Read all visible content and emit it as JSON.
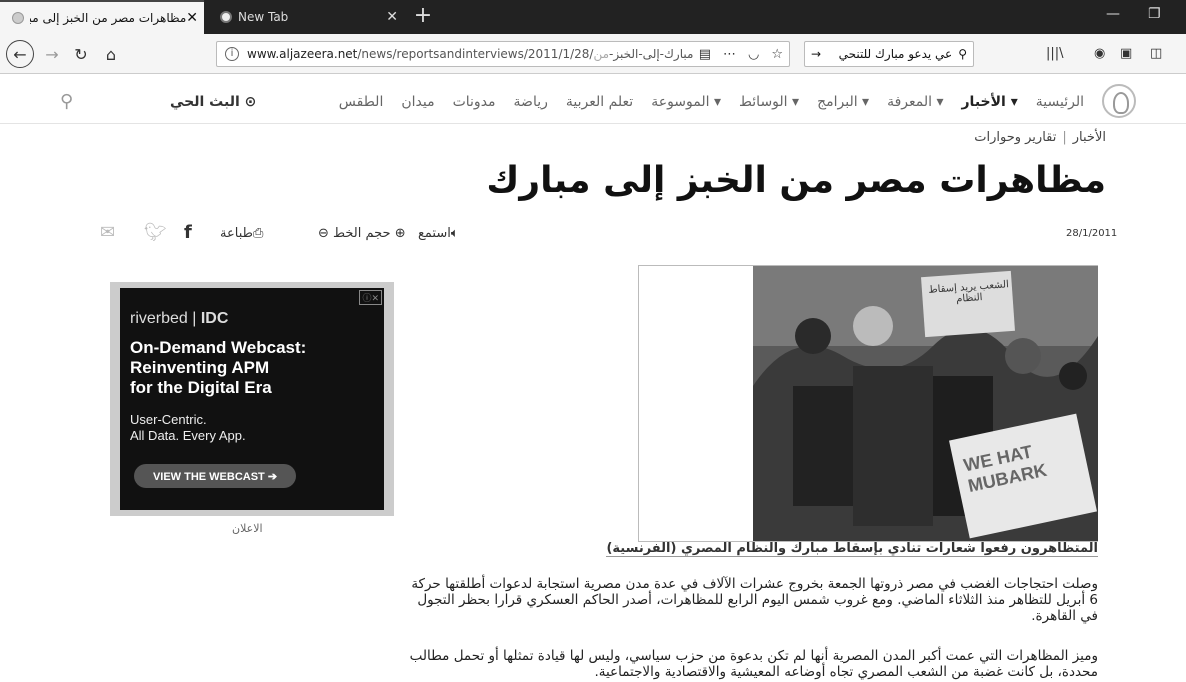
{
  "browser": {
    "active_tab_title": "مظاهرات مصر من الخبز إلى مبارك",
    "inactive_tab_title": "New Tab",
    "url_domain": "www.aljazeera.net",
    "url_path": "/news/reportsandinterviews/2011/1/28/مبارك-إلى-الخبز-",
    "url_tail": "من",
    "search_text": "عي يدعو مبارك للتنحي"
  },
  "site": {
    "menu": [
      {
        "label": "الرئيسية",
        "bold": false
      },
      {
        "label": "الأخبار ▾",
        "bold": true
      },
      {
        "label": "المعرفة ▾",
        "bold": false
      },
      {
        "label": "البرامج ▾",
        "bold": false
      },
      {
        "label": "الوسائط ▾",
        "bold": false
      },
      {
        "label": "الموسوعة ▾",
        "bold": false
      },
      {
        "label": "تعلم العربية",
        "bold": false
      },
      {
        "label": "رياضة",
        "bold": false
      },
      {
        "label": "مدونات",
        "bold": false
      },
      {
        "label": "ميدان",
        "bold": false
      },
      {
        "label": "الطقس",
        "bold": false
      }
    ],
    "live_label": "البث الحي"
  },
  "article": {
    "breadcrumb_1": "الأخبار",
    "breadcrumb_2": "تقارير وحوارات",
    "title": "مظاهرات مصر من الخبز إلى مبارك",
    "date": "28/1/2011",
    "listen_label": "استمع",
    "font_size_label": "حجم الخط",
    "print_label": "طباعة",
    "photo_sign_1": "الشعب يريد إسقاط النظام",
    "photo_sign_2": "WE HAT MUBARK",
    "caption": "المتظاهرون رفعوا شعارات تنادي بإسقاط مبارك والنظام المصري (الفرنسية)",
    "paragraphs": [
      "وصلت احتجاجات الغضب في مصر ذروتها الجمعة بخروج عشرات الآلاف في عدة مدن مصرية استجابة لدعوات أطلقتها حركة 6 أبريل للتظاهر منذ الثلاثاء الماضي. ومع غروب شمس اليوم الرابع للمظاهرات، أصدر الحاكم العسكري قرارا بحظر التجول في القاهرة.",
      "وميز المظاهرات التي عمت أكبر المدن المصرية أنها لم تكن بدعوة من حزب سياسي، وليس لها قيادة تمثلها أو تحمل مطالب محددة، بل كانت غضبة من الشعب المصري تجاه أوضاعه المعيشية والاقتصادية والاجتماعية."
    ]
  },
  "ad": {
    "brand_1": "riverbed",
    "brand_2": "IDC",
    "title_lines": [
      "On-Demand Webcast:",
      "Reinventing APM",
      "for the Digital Era"
    ],
    "sub_lines": [
      "User-Centric.",
      "All Data. Every App."
    ],
    "button": "VIEW THE WEBCAST ➔",
    "label": "الاعلان"
  }
}
